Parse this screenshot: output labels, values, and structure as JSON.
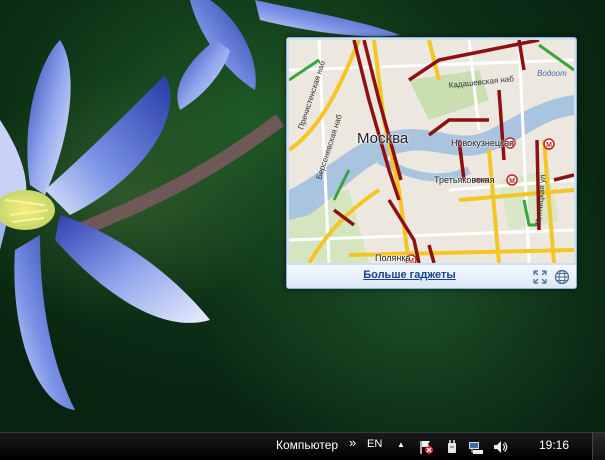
{
  "gadget": {
    "map": {
      "city_label": "Москва",
      "street_labels": {
        "prechistenskaya": "Пречистенская наб",
        "bersenevskaya": "Берсеневская наб",
        "kadashevskaya": "Кадашевская наб",
        "vodootvodny": "Водоот",
        "pyatnitskaya": "Пятницкая ул",
        "polyanka": "Полянка"
      },
      "metro_labels": {
        "novokuznetskaya": "Новокузнецкая",
        "tretyakovskaya": "Третьяковская"
      },
      "metro_marker": "М"
    },
    "footer": {
      "link": "Больше гаджеты",
      "fullscreen_icon": "expand-icon",
      "globe_icon": "globe-icon"
    }
  },
  "taskbar": {
    "toolbar_label": "Компьютер",
    "toolbar_chevron": "»",
    "language": "EN",
    "tray_arrow": "▲",
    "tray_icons": [
      "action-center-flag-icon",
      "power-icon",
      "network-icon",
      "volume-icon"
    ],
    "clock": "19:16"
  }
}
